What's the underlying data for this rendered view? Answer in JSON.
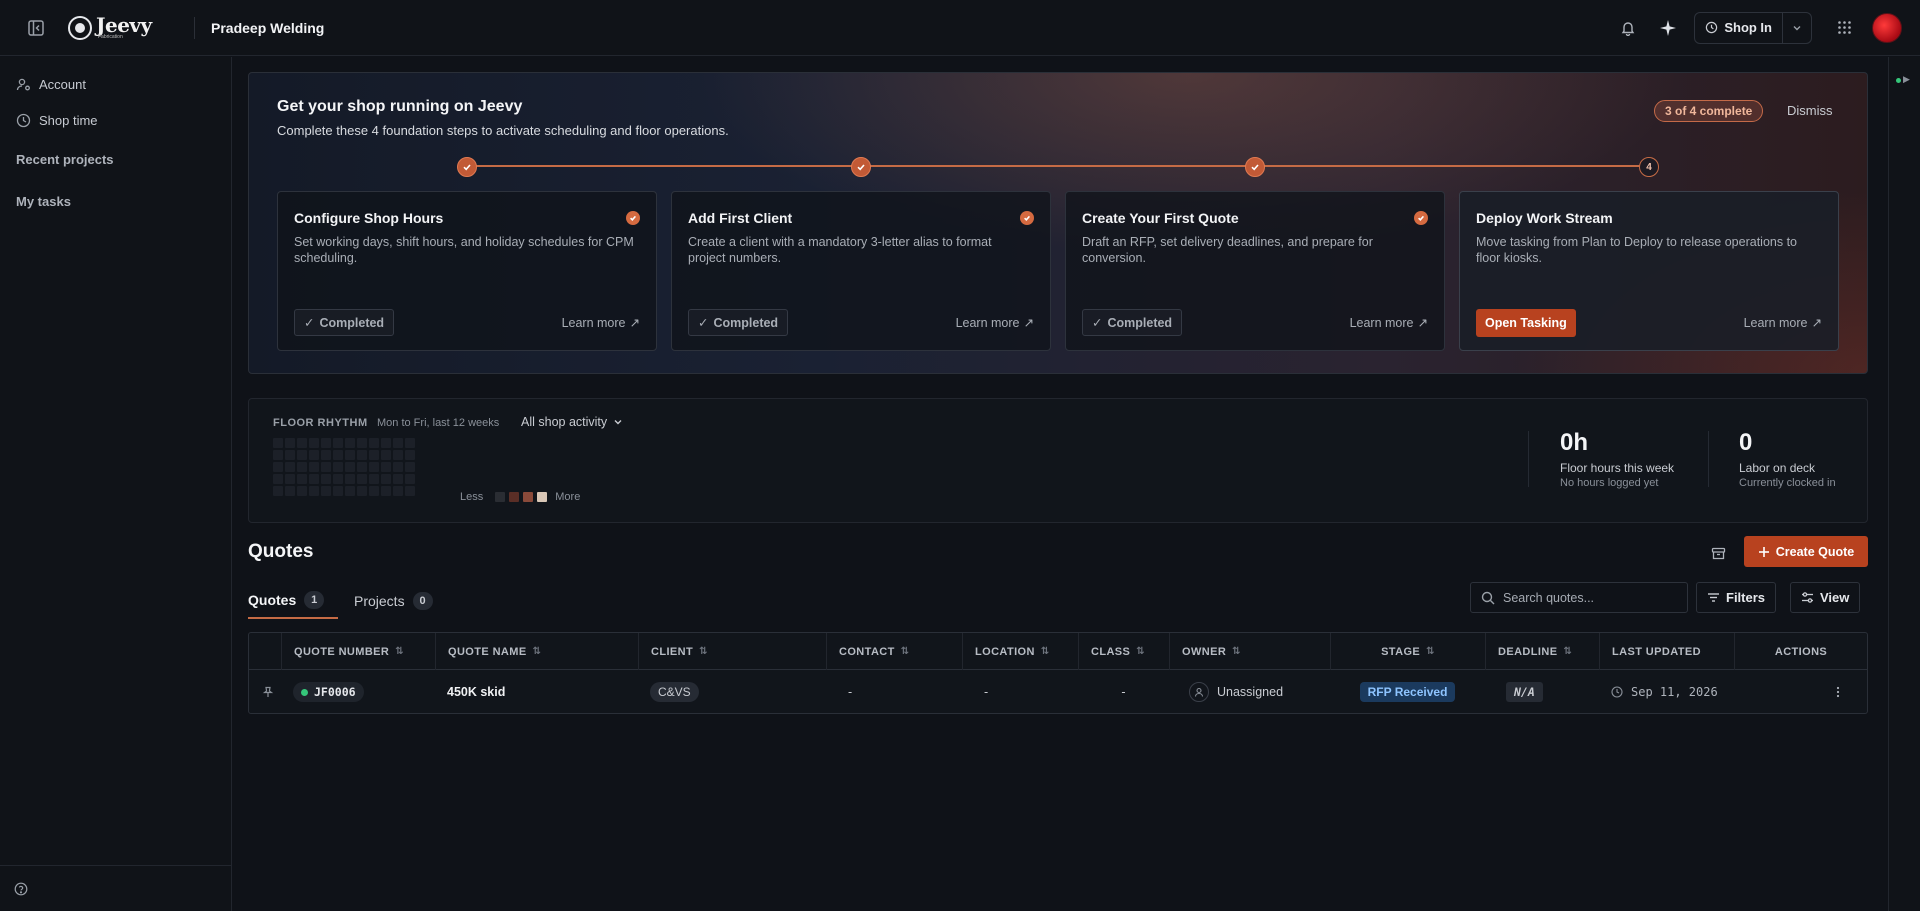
{
  "header": {
    "logo_text": "Jeevy",
    "logo_sub": "Fabrication",
    "shop_name": "Pradeep Welding",
    "shop_in_label": "Shop In"
  },
  "sidebar": {
    "items": [
      {
        "label": "Account",
        "icon": "user-gear-icon"
      },
      {
        "label": "Shop time",
        "icon": "clock-icon"
      }
    ],
    "sections": [
      "Recent projects",
      "My tasks"
    ]
  },
  "onboarding": {
    "title": "Get your shop running on Jeevy",
    "subtitle": "Complete these 4 foundation steps to activate scheduling and floor operations.",
    "badge": "3 of 4 complete",
    "dismiss": "Dismiss",
    "pending_step_number": "4",
    "cards": [
      {
        "title": "Configure Shop Hours",
        "desc": "Set working days, shift hours, and holiday schedules for CPM scheduling.",
        "status": "Completed",
        "learn": "Learn more"
      },
      {
        "title": "Add First Client",
        "desc": "Create a client with a mandatory 3-letter alias to format project numbers.",
        "status": "Completed",
        "learn": "Learn more"
      },
      {
        "title": "Create Your First Quote",
        "desc": "Draft an RFP, set delivery deadlines, and prepare for conversion.",
        "status": "Completed",
        "learn": "Learn more"
      },
      {
        "title": "Deploy Work Stream",
        "desc": "Move tasking from Plan to Deploy to release operations to floor kiosks.",
        "action": "Open Tasking",
        "learn": "Learn more"
      }
    ]
  },
  "rhythm": {
    "label": "FLOOR RHYTHM",
    "range": "Mon to Fri, last 12 weeks",
    "filter": "All shop activity",
    "legend_less": "Less",
    "legend_more": "More",
    "legend_colors": [
      "#2a2d33",
      "#5a2e26",
      "#8a4a3a",
      "#d9c7b6"
    ],
    "stats": [
      {
        "value": "0h",
        "label": "Floor hours this week",
        "sub": "No hours logged yet"
      },
      {
        "value": "0",
        "label": "Labor on deck",
        "sub": "Currently clocked in"
      }
    ]
  },
  "quotes": {
    "title": "Quotes",
    "create_label": "Create Quote",
    "tabs": [
      {
        "label": "Quotes",
        "count": "1"
      },
      {
        "label": "Projects",
        "count": "0"
      }
    ],
    "search_placeholder": "Search quotes...",
    "filters_label": "Filters",
    "view_label": "View",
    "columns": [
      "QUOTE NUMBER",
      "QUOTE NAME",
      "CLIENT",
      "CONTACT",
      "LOCATION",
      "CLASS",
      "OWNER",
      "STAGE",
      "DEADLINE",
      "LAST UPDATED",
      "ACTIONS"
    ],
    "rows": [
      {
        "number": "JF0006",
        "name": "450K skid",
        "client": "C&VS",
        "contact": "-",
        "location": "-",
        "class": "-",
        "owner": "Unassigned",
        "stage": "RFP Received",
        "deadline": "N/A",
        "updated": "Sep 11, 2026"
      }
    ]
  }
}
